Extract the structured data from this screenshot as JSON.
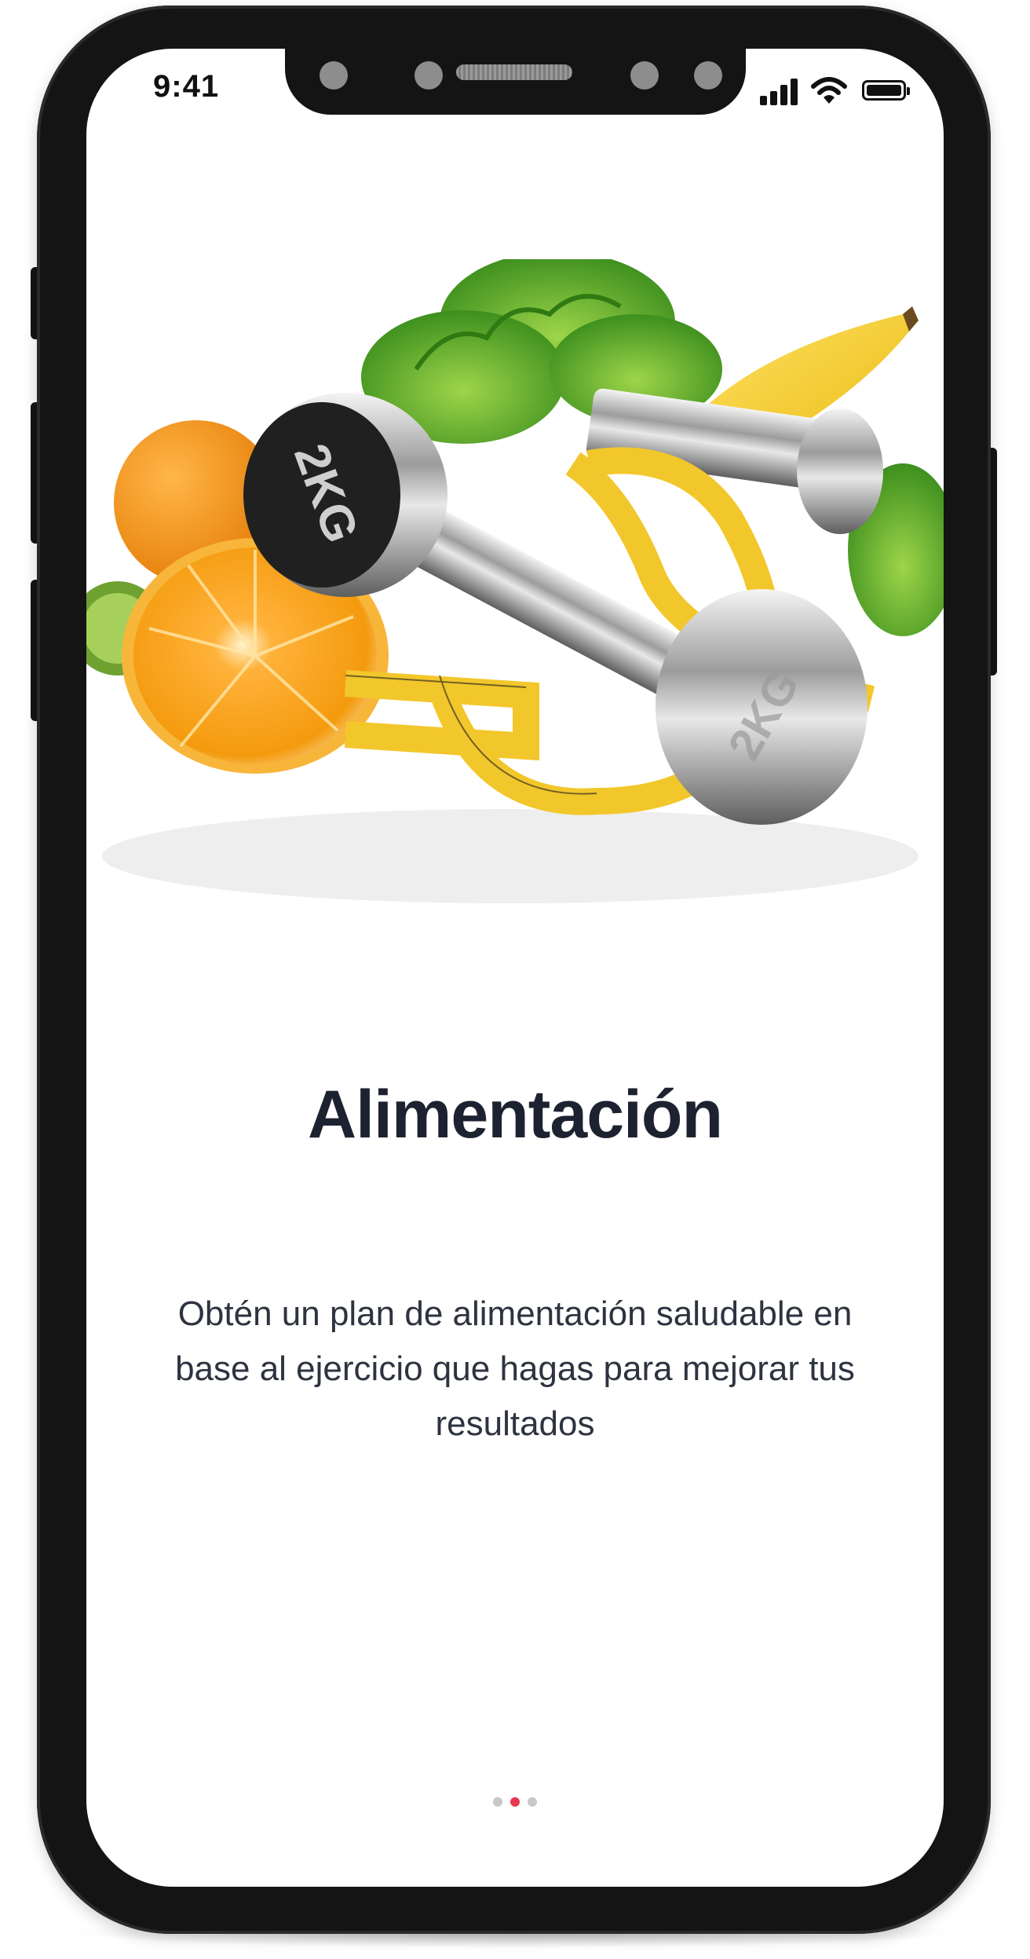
{
  "status_bar": {
    "time": "9:41",
    "icons": [
      "signal-icon",
      "wifi-icon",
      "battery-icon"
    ]
  },
  "onboarding": {
    "title": "Alimentación",
    "description": "Obtén un plan de alimentación saludable en base al ejercicio que hagas para mejorar tus resultados",
    "image_label": "2KG",
    "page_indicator": {
      "count": 3,
      "active_index": 1
    }
  },
  "colors": {
    "active_dot": "#e53950",
    "inactive_dot": "#c8c8c8",
    "title": "#1c2230",
    "text": "#2e3340"
  }
}
